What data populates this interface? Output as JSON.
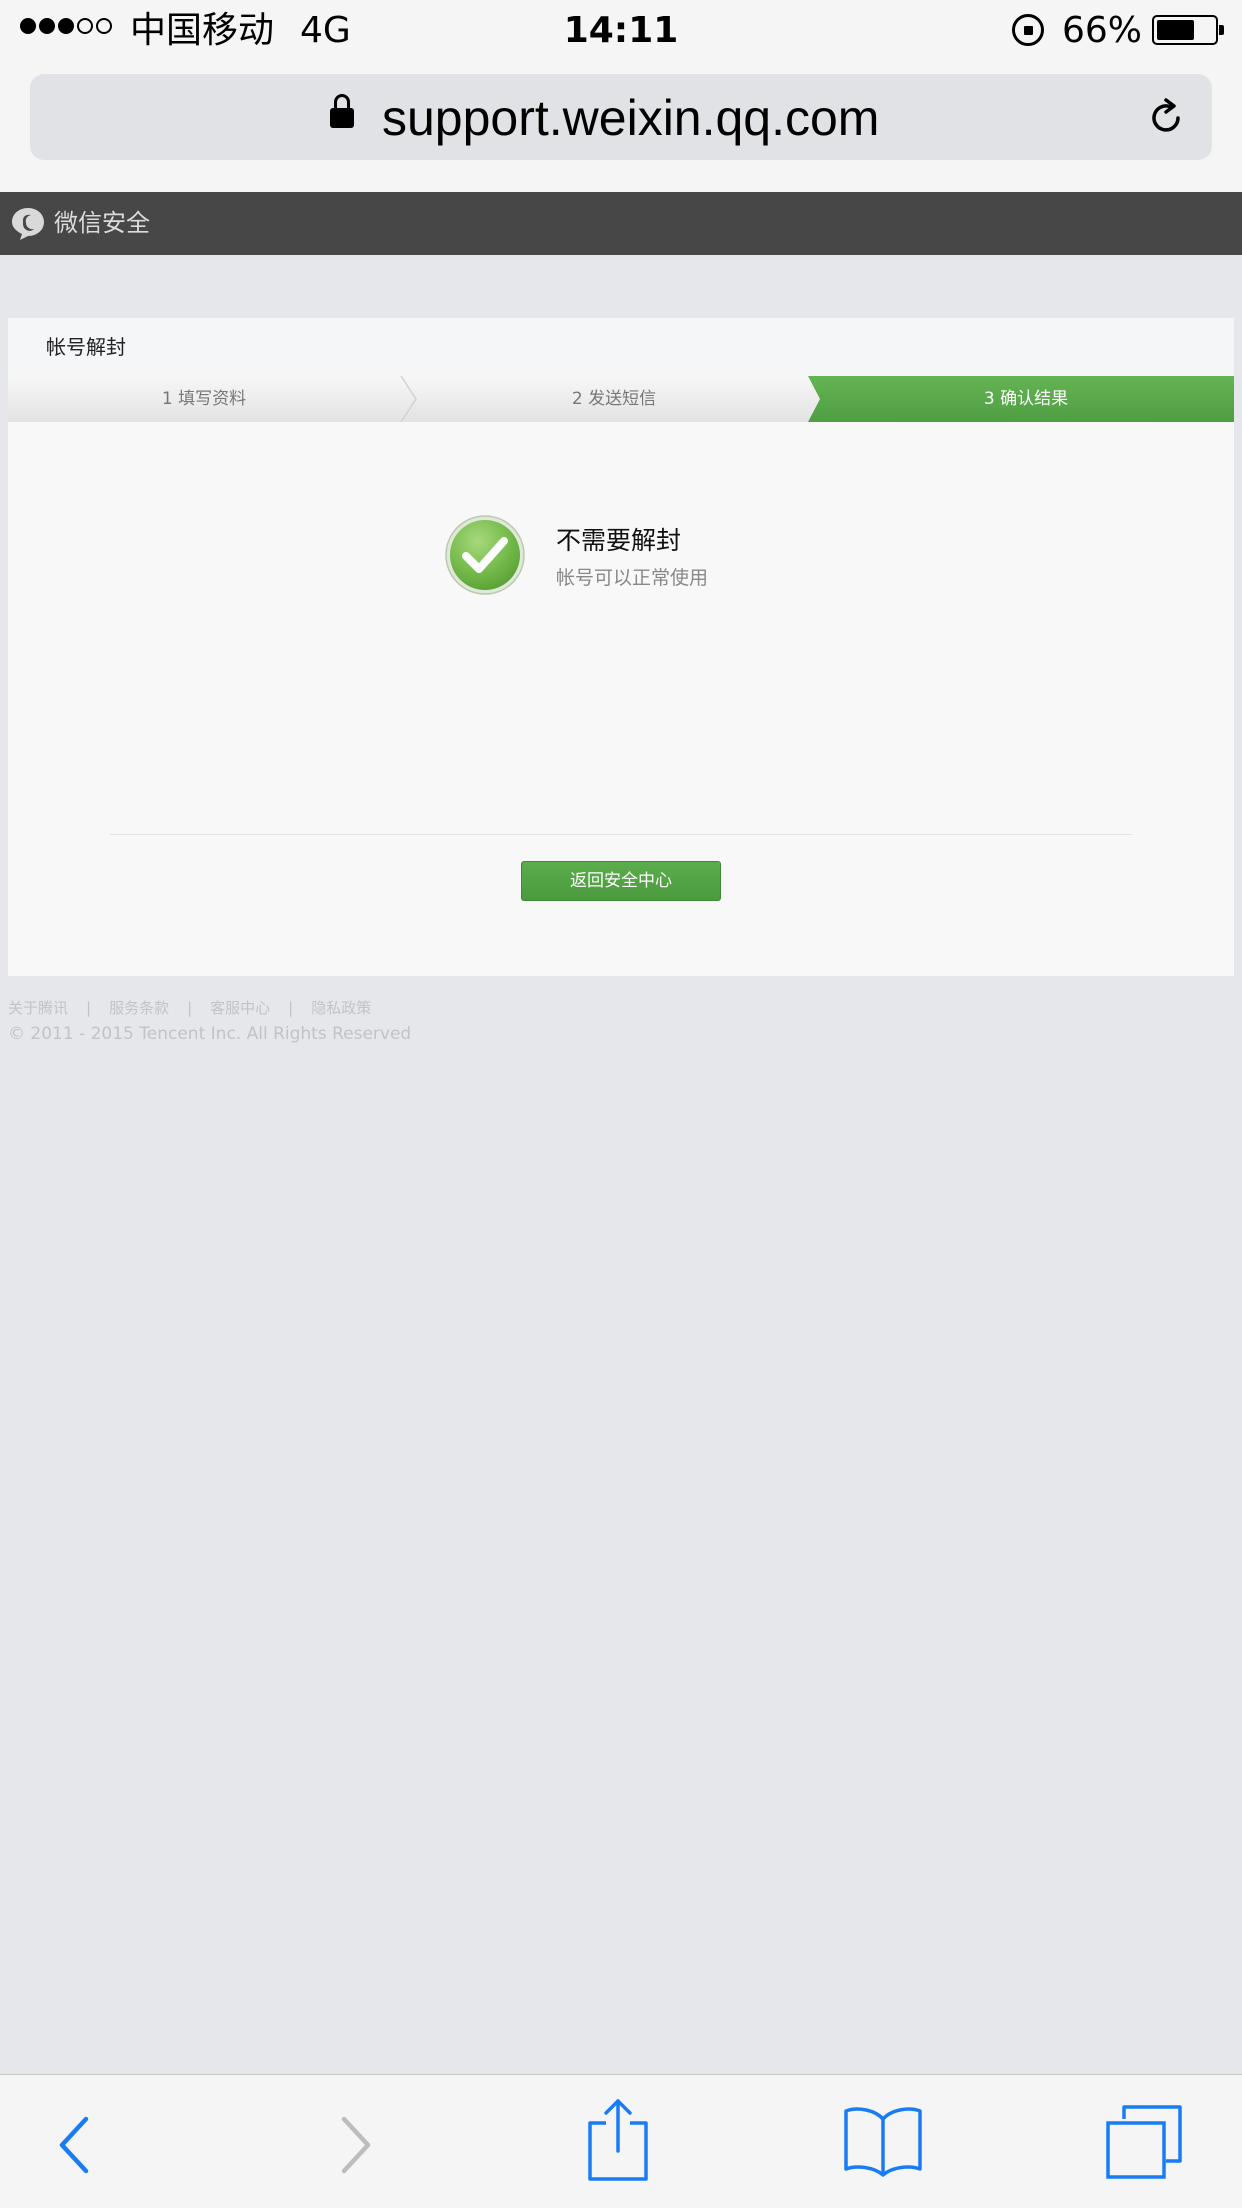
{
  "status_bar": {
    "carrier": "中国移动",
    "network": "4G",
    "time": "14:11",
    "battery_percent": "66%",
    "battery_level": 0.66,
    "signal_bars_filled": 3,
    "signal_bars_total": 5
  },
  "browser": {
    "url": "support.weixin.qq.com"
  },
  "header": {
    "brand": "微信安全"
  },
  "card": {
    "title": "帐号解封",
    "steps": [
      {
        "label": "1 填写资料",
        "active": false
      },
      {
        "label": "2 发送短信",
        "active": false
      },
      {
        "label": "3 确认结果",
        "active": true
      }
    ],
    "result": {
      "title": "不需要解封",
      "subtitle": "帐号可以正常使用"
    },
    "back_button": "返回安全中心"
  },
  "footer": {
    "links": [
      "关于腾讯",
      "服务条款",
      "客服中心",
      "隐私政策"
    ],
    "separator": "|",
    "copyright": "© 2011 - 2015 Tencent Inc. All Rights Reserved"
  },
  "colors": {
    "accent_green": "#5aa84c",
    "header_bg": "#474747",
    "ios_blue": "#1a7cf5"
  },
  "toolbar": {
    "icons": [
      "back-icon",
      "forward-icon",
      "share-icon",
      "bookmarks-icon",
      "tabs-icon"
    ]
  }
}
